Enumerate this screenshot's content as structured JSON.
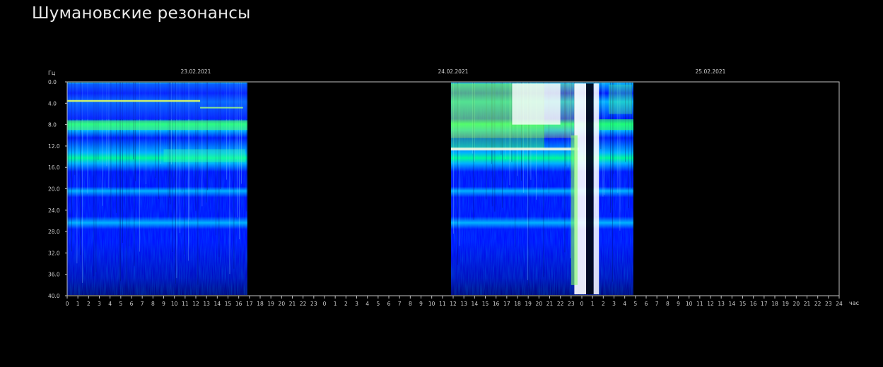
{
  "page": {
    "title": "Шумановские резонансы"
  },
  "chart_data": {
    "type": "heatmap",
    "title": "",
    "ylabel": "Гц",
    "xlabel": "час",
    "ylim": [
      0,
      40
    ],
    "y_direction": "top-to-bottom",
    "y_ticks": [
      "0.0",
      "4.0",
      "8.0",
      "12.0",
      "16.0",
      "20.0",
      "24.0",
      "28.0",
      "32.0",
      "36.0",
      "40.0"
    ],
    "x_range_hours": [
      0,
      72
    ],
    "x_ticks": [
      "0",
      "1",
      "2",
      "3",
      "4",
      "5",
      "6",
      "7",
      "8",
      "9",
      "10",
      "11",
      "12",
      "13",
      "14",
      "15",
      "16",
      "17",
      "18",
      "19",
      "20",
      "21",
      "22",
      "23",
      "0",
      "1",
      "2",
      "3",
      "4",
      "5",
      "6",
      "7",
      "8",
      "9",
      "10",
      "11",
      "12",
      "13",
      "14",
      "15",
      "16",
      "17",
      "18",
      "19",
      "20",
      "21",
      "22",
      "23",
      "0",
      "1",
      "2",
      "3",
      "4",
      "5",
      "6",
      "7",
      "8",
      "9",
      "10",
      "11",
      "12",
      "13",
      "14",
      "15",
      "16",
      "17",
      "18",
      "19",
      "20",
      "21",
      "22",
      "23",
      "24"
    ],
    "dates": [
      {
        "label": "23.02.2021",
        "center_hour": 12
      },
      {
        "label": "24.02.2021",
        "center_hour": 36
      },
      {
        "label": "25.02.2021",
        "center_hour": 60
      }
    ],
    "data_segments": [
      {
        "start_hour": 0,
        "end_hour": 16.8
      },
      {
        "start_hour": 35.8,
        "end_hour": 52.8
      }
    ],
    "resonance_bands_hz": [
      7.8,
      14.1,
      20.3,
      26.4
    ],
    "color_scale": [
      "#000040",
      "#0014ff",
      "#00b4ff",
      "#00ff90",
      "#ffff00",
      "#ff3000",
      "#ffffff"
    ],
    "grid": false,
    "legend": "none"
  }
}
